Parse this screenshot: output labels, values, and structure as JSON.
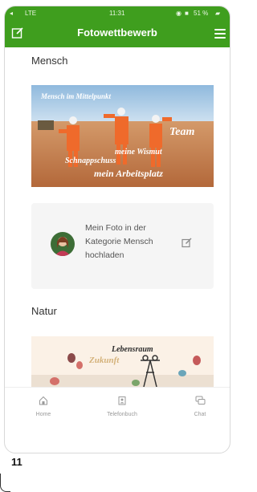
{
  "status_bar": {
    "network": "LTE",
    "time": "11:31",
    "battery": "51 %"
  },
  "header": {
    "title": "Fotowettbewerb"
  },
  "sections": [
    {
      "title": "Mensch",
      "image_texts": {
        "top_left": "Mensch im Mittelpunkt",
        "team": "Team",
        "wismut": "meine Wismut",
        "schnappschuss": "Schnappschuss",
        "arbeitsplatz": "mein Arbeitsplatz"
      }
    },
    {
      "title": "Natur",
      "image_texts": {
        "lebensraum": "Lebensraum",
        "zukunft": "Zukunft"
      }
    }
  ],
  "upload_card": {
    "text": "Mein Foto in der Kategorie Mensch hochladen"
  },
  "bottom_nav": [
    {
      "label": "Home",
      "icon": "home-icon"
    },
    {
      "label": "Telefonbuch",
      "icon": "phonebook-icon"
    },
    {
      "label": "Chat",
      "icon": "chat-icon"
    }
  ],
  "page_number": "11",
  "colors": {
    "brand_green": "#3f9e1e",
    "muted_grey": "#9a9a9a"
  }
}
